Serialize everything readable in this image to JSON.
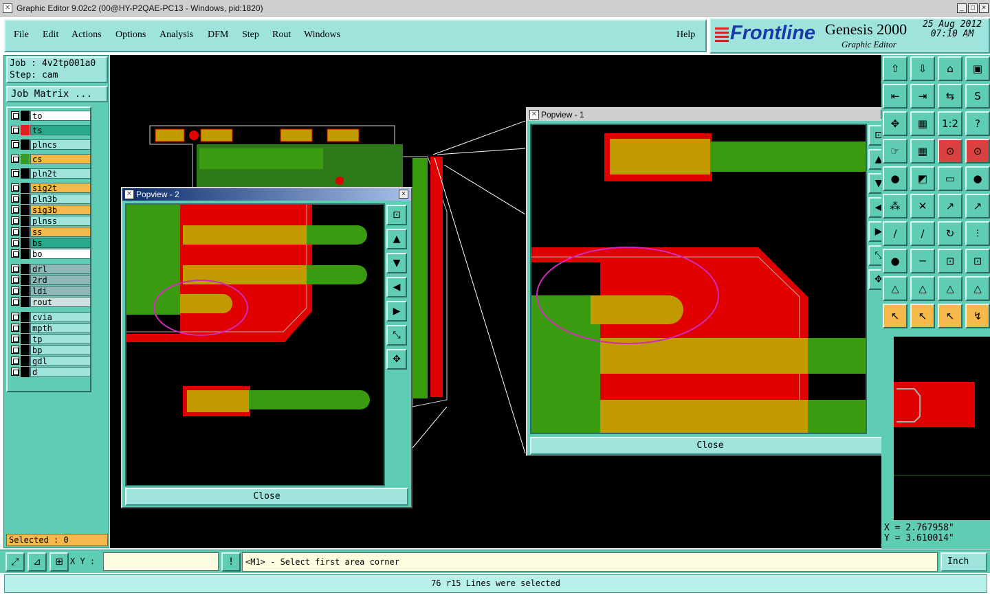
{
  "window": {
    "title": "Graphic Editor 9.02c2 (00@HY-P2QAE-PC13 - Windows, pid:1820)",
    "minimize": "_",
    "maximize": "□",
    "close": "×"
  },
  "menubar": {
    "items": [
      "File",
      "Edit",
      "Actions",
      "Options",
      "Analysis",
      "DFM",
      "Step",
      "Rout",
      "Windows"
    ],
    "help": "Help"
  },
  "brand": {
    "logo": "Frontline",
    "product": "Genesis 2000",
    "subtitle": "Graphic Editor",
    "date": "25 Aug 2012",
    "time": "07:10 AM"
  },
  "job": {
    "job_label": "Job : 4v2tp001a0",
    "step_label": "Step: cam",
    "matrix_button": "Job Matrix ..."
  },
  "layers": [
    {
      "name": "to",
      "color": "#ffffff",
      "dot": "#000000"
    },
    {
      "name": "ts",
      "color": "#2aa88a",
      "dot": "#e02020"
    },
    {
      "name": "plncs",
      "color": "#9ee3dc",
      "dot": "#000000"
    },
    {
      "name": "cs",
      "color": "#f5b84a",
      "dot": "#3a9a2a"
    },
    {
      "name": "pln2t",
      "color": "#9ee3dc",
      "dot": "#000000"
    },
    {
      "name": "sig2t",
      "color": "#f5b84a",
      "dot": "#000000"
    },
    {
      "name": "pln3b",
      "color": "#9ee3dc",
      "dot": "#000000"
    },
    {
      "name": "sig3b",
      "color": "#f5b84a",
      "dot": "#000000"
    },
    {
      "name": "plnss",
      "color": "#9ee3dc",
      "dot": "#000000"
    },
    {
      "name": "ss",
      "color": "#f5b84a",
      "dot": "#000000"
    },
    {
      "name": "bs",
      "color": "#2aa88a",
      "dot": "#000000"
    },
    {
      "name": "bo",
      "color": "#ffffff",
      "dot": "#000000"
    },
    {
      "name": "drl",
      "color": "#8fb8b8",
      "dot": "#000000"
    },
    {
      "name": "2rd",
      "color": "#8fb8b8",
      "dot": "#000000"
    },
    {
      "name": "ldi",
      "color": "#8fb8b8",
      "dot": "#000000"
    },
    {
      "name": "rout",
      "color": "#cfe0e0",
      "dot": "#000000"
    },
    {
      "name": "cvia",
      "color": "#9ee3dc",
      "dot": "#000000"
    },
    {
      "name": "mpth",
      "color": "#9ee3dc",
      "dot": "#000000"
    },
    {
      "name": "tp",
      "color": "#9ee3dc",
      "dot": "#000000"
    },
    {
      "name": "bp",
      "color": "#9ee3dc",
      "dot": "#000000"
    },
    {
      "name": "gdl",
      "color": "#9ee3dc",
      "dot": "#000000"
    },
    {
      "name": "d",
      "color": "#9ee3dc",
      "dot": "#000000"
    }
  ],
  "selected": "Selected : 0",
  "popview2": {
    "title": "Popview - 2",
    "close_label": "Close",
    "close_x": "×"
  },
  "popview1": {
    "title": "Popview - 1",
    "close_label": "Close",
    "close_x": "×"
  },
  "coords": {
    "x": "X = 2.767958\"",
    "y": "Y = 3.610014\""
  },
  "bottombar": {
    "xy_label": "X Y :",
    "xy_value": "",
    "prompt": "<M1> - Select first area corner",
    "unit": "Inch",
    "bang": "!"
  },
  "status": "76 r15 Lines were selected",
  "colors": {
    "panel": "#5ecdb3",
    "copper": "#e00000",
    "trace": "#3a9a10",
    "overlap": "#c19a00",
    "highlight": "#d02ab8"
  },
  "toolbar_icons": [
    "layer-up-icon",
    "layer-down-icon",
    "home-icon",
    "window-icon",
    "prev-icon",
    "next-icon",
    "swap-icon",
    "s-icon",
    "zoom-in-icon",
    "fit-icon",
    "ratio-icon",
    "help-icon",
    "hand-icon",
    "grid-icon",
    "snap-icon",
    "snap-red-icon"
  ]
}
